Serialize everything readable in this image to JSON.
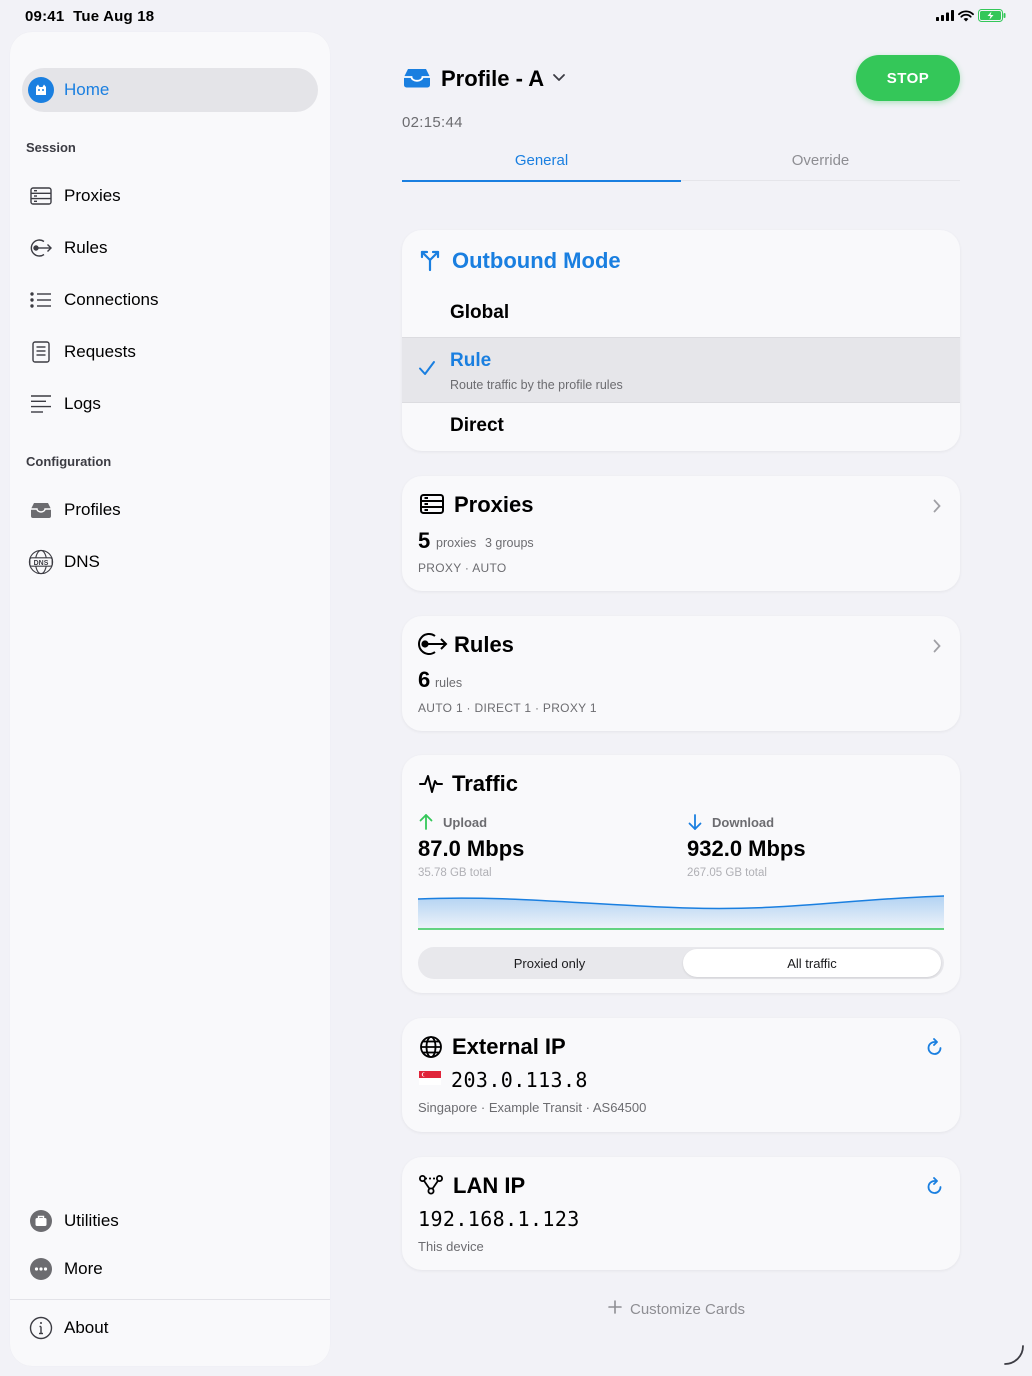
{
  "status_bar": {
    "time": "09:41",
    "date": "Tue Aug 18"
  },
  "sidebar": {
    "home": "Home",
    "session_header": "Session",
    "session_items": [
      "Proxies",
      "Rules",
      "Connections",
      "Requests",
      "Logs"
    ],
    "config_header": "Configuration",
    "config_items": [
      "Profiles",
      "DNS"
    ],
    "bottom_items": [
      "Utilities",
      "More"
    ],
    "about": "About"
  },
  "header": {
    "profile_name": "Profile - A",
    "elapsed": "02:15:44",
    "stop_label": "STOP"
  },
  "tabs": [
    "General",
    "Override"
  ],
  "outbound_mode": {
    "title": "Outbound Mode",
    "options": [
      {
        "name": "Global"
      },
      {
        "name": "Rule",
        "description": "Route traffic by the profile rules",
        "selected": true
      },
      {
        "name": "Direct"
      }
    ]
  },
  "proxies_card": {
    "title": "Proxies",
    "count": "5",
    "count_unit": "proxies",
    "groups": "3 groups",
    "meta": "PROXY · AUTO"
  },
  "rules_card": {
    "title": "Rules",
    "count": "6",
    "count_unit": "rules",
    "meta": "AUTO 1 · DIRECT 1 · PROXY 1"
  },
  "traffic_card": {
    "title": "Traffic",
    "upload_label": "Upload",
    "upload_value": "87.0 Mbps",
    "upload_total": "35.78 GB total",
    "download_label": "Download",
    "download_value": "932.0 Mbps",
    "download_total": "267.05 GB total",
    "segment_options": [
      "Proxied only",
      "All traffic"
    ],
    "segment_selected": "All traffic"
  },
  "external_ip_card": {
    "title": "External IP",
    "ip": "203.0.113.8",
    "info": "Singapore · Example Transit · AS64500"
  },
  "lan_ip_card": {
    "title": "LAN IP",
    "ip": "192.168.1.123",
    "info": "This device"
  },
  "customize_label": "Customize Cards",
  "colors": {
    "accent": "#1a7fe0",
    "stop": "#34c759",
    "upload": "#34c759",
    "download": "#1a7fe0"
  }
}
